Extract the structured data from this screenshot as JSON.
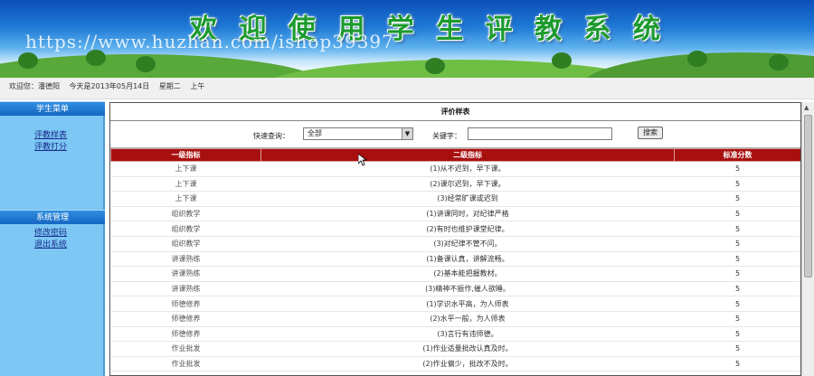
{
  "banner": {
    "title_chars": [
      "欢",
      "迎",
      "使",
      "用",
      "学",
      "生",
      "评",
      "教",
      "系",
      "统"
    ],
    "watermark": "https://www.huzhan.com/ishop39397"
  },
  "welcome": {
    "greeting": "欢迎您：潘德阳",
    "date": "今天是2013年05月14日",
    "weekday": "星期二",
    "period": "上午"
  },
  "sidebar": {
    "group1_title": "学生菜单",
    "group1_items": [
      "评教样表",
      "评教打分"
    ],
    "group2_title": "系统管理",
    "group2_items": [
      "修改密码",
      "退出系统"
    ]
  },
  "panel": {
    "title": "评价样表",
    "quick_query_label": "快速查询：",
    "quick_query_value": "全部",
    "keyword_label": "关键字：",
    "keyword_value": "",
    "search_button": "搜索"
  },
  "table": {
    "headers": [
      "一级指标",
      "二级指标",
      "标准分数"
    ],
    "rows": [
      [
        "上下课",
        "(1)从不迟到，早下课。",
        "5"
      ],
      [
        "上下课",
        "(2)课尔迟到，早下课。",
        "5"
      ],
      [
        "上下课",
        "(3)经常旷课或迟到",
        "5"
      ],
      [
        "组织教学",
        "(1)讲课同时，对纪律严格",
        "5"
      ],
      [
        "组织教学",
        "(2)有时也维护课堂纪律。",
        "5"
      ],
      [
        "组织教学",
        "(3)对纪律不管不问。",
        "5"
      ],
      [
        "讲课熟练",
        "(1)备课认真，讲解流畅。",
        "5"
      ],
      [
        "讲课熟练",
        "(2)基本能把握教材。",
        "5"
      ],
      [
        "讲课熟练",
        "(3)精神不振作,催人欲睡。",
        "5"
      ],
      [
        "师德修养",
        "(1)学识水平高，为人师表",
        "5"
      ],
      [
        "师德修养",
        "(2)水平一般，为人师表",
        "5"
      ],
      [
        "师德修养",
        "(3)言行有违师德。",
        "5"
      ],
      [
        "作业批发",
        "(1)作业适量批改认真及时。",
        "5"
      ],
      [
        "作业批发",
        "(2)作业偏少，批改不及时。",
        "5"
      ]
    ]
  },
  "colors": {
    "header_red": "#a80f0f",
    "sidebar_blue": "#7cc7f3",
    "menu_head_blue": "#1566c2"
  }
}
